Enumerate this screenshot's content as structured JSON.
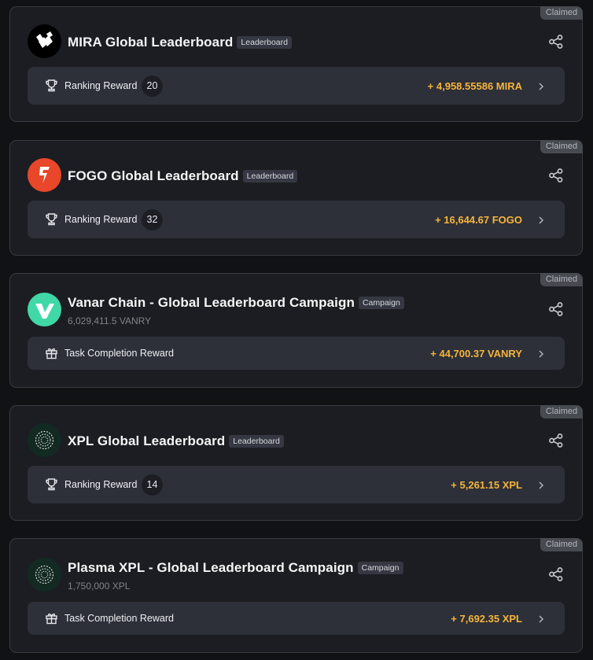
{
  "claimed_label": "Claimed",
  "cards": [
    {
      "logo": "mira-logo",
      "title": "MIRA Global Leaderboard",
      "badge": "Leaderboard",
      "subline": "",
      "reward_icon": "trophy-icon",
      "reward_label": "Ranking Reward",
      "rank": "20",
      "amount": "+ 4,958.55586 MIRA"
    },
    {
      "logo": "fogo-logo",
      "title": "FOGO Global Leaderboard",
      "badge": "Leaderboard",
      "subline": "",
      "reward_icon": "trophy-icon",
      "reward_label": "Ranking Reward",
      "rank": "32",
      "amount": "+ 16,644.67 FOGO"
    },
    {
      "logo": "vanar-logo",
      "title": "Vanar Chain - Global Leaderboard Campaign",
      "badge": "Campaign",
      "subline": "6,029,411.5 VANRY",
      "reward_icon": "gift-icon",
      "reward_label": "Task Completion Reward",
      "rank": "",
      "amount": "+ 44,700.37 VANRY"
    },
    {
      "logo": "xpl-logo",
      "title": "XPL Global Leaderboard",
      "badge": "Leaderboard",
      "subline": "",
      "reward_icon": "trophy-icon",
      "reward_label": "Ranking Reward",
      "rank": "14",
      "amount": "+ 5,261.15 XPL"
    },
    {
      "logo": "xpl-logo",
      "title": "Plasma XPL - Global Leaderboard Campaign",
      "badge": "Campaign",
      "subline": "1,750,000 XPL",
      "reward_icon": "gift-icon",
      "reward_label": "Task Completion Reward",
      "rank": "",
      "amount": "+ 7,692.35 XPL"
    }
  ],
  "colors": {
    "background": "#111215",
    "card": "#1c1d22",
    "reward_row": "#2d3039",
    "amount": "#f6b43a",
    "mira_logo": "#000000",
    "fogo_logo": "#e8472a",
    "vanar_logo": "#3fd8a6",
    "xpl_logo": "#132a22"
  }
}
